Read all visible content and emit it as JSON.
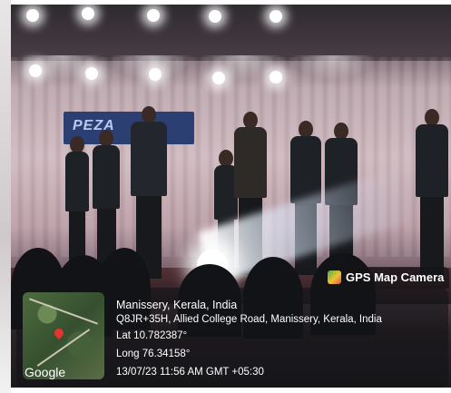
{
  "stage_banner": {
    "text": "PEZA"
  },
  "gps_overlay": {
    "app_label": "GPS Map Camera",
    "map_brand": "Google",
    "place": "Manissery, Kerala, India",
    "address": "Q8JR+35H, Allied College Road, Manissery, Kerala, India",
    "latitude": "Lat 10.782387°",
    "longitude": "Long 76.34158°",
    "timestamp": "13/07/23 11:56 AM GMT +05:30"
  }
}
